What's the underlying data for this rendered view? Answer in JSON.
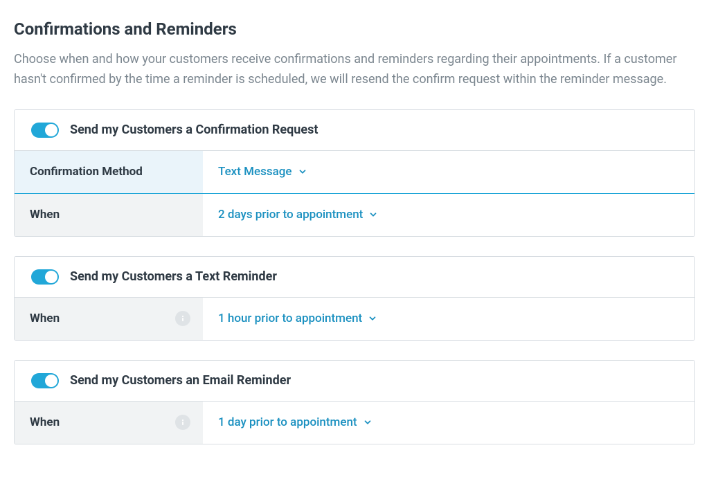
{
  "page": {
    "title": "Confirmations and Reminders",
    "description": "Choose when and how your customers receive confirmations and reminders regarding their appointments. If a customer hasn't confirmed by the time a reminder is scheduled, we will resend the confirm request within the reminder message."
  },
  "sections": {
    "confirmation_request": {
      "enabled": true,
      "title": "Send my Customers a Confirmation Request",
      "rows": {
        "method": {
          "label": "Confirmation Method",
          "value": "Text Message"
        },
        "when": {
          "label": "When",
          "value": "2 days prior to appointment"
        }
      }
    },
    "text_reminder": {
      "enabled": true,
      "title": "Send my Customers a Text Reminder",
      "rows": {
        "when": {
          "label": "When",
          "value": "1 hour prior to appointment"
        }
      }
    },
    "email_reminder": {
      "enabled": true,
      "title": "Send my Customers an Email Reminder",
      "rows": {
        "when": {
          "label": "When",
          "value": "1 day prior to appointment"
        }
      }
    }
  },
  "colors": {
    "accent": "#21a7d8",
    "text_muted": "#7b868f"
  }
}
